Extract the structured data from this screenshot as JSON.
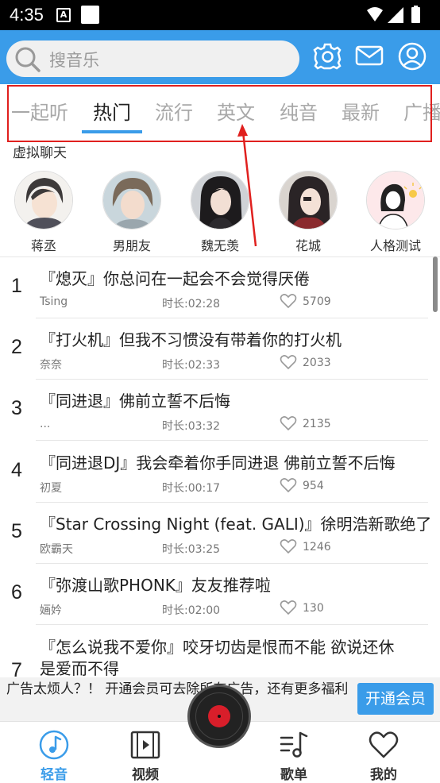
{
  "status_bar": {
    "time": "4:35",
    "notif_a": "A"
  },
  "header": {
    "search_placeholder": "搜音乐",
    "icons": [
      "gear-icon",
      "mail-icon",
      "user-icon"
    ]
  },
  "tabs": [
    "一起听",
    "热门",
    "流行",
    "英文",
    "纯音",
    "最新",
    "广播"
  ],
  "active_tab": "热门",
  "virtual_chat": {
    "title": "虚拟聊天",
    "characters": [
      "蒋丞",
      "男朋友",
      "魏无羡",
      "花城",
      "人格测试"
    ]
  },
  "songs": [
    {
      "rank": "1",
      "title": "『熄灭』你总问在一起会不会觉得厌倦",
      "artist": "Tsing",
      "duration": "时长:02:28",
      "likes": "5709"
    },
    {
      "rank": "2",
      "title": "『打火机』但我不习惯没有带着你的打火机",
      "artist": "奈奈",
      "duration": "时长:02:33",
      "likes": "2033"
    },
    {
      "rank": "3",
      "title": "『同进退』佛前立誓不后悔",
      "artist": "...",
      "duration": "时长:03:32",
      "likes": "2135"
    },
    {
      "rank": "4",
      "title": "『同进退DJ』我会牵着你手同进退 佛前立誓不后悔",
      "artist": "初夏",
      "duration": "时长:00:17",
      "likes": "954"
    },
    {
      "rank": "5",
      "title": "『Star Crossing Night (feat. GALI)』徐明浩新歌绝了",
      "artist": "欧霸天",
      "duration": "时长:03:25",
      "likes": "1246"
    },
    {
      "rank": "6",
      "title": "『弥渡山歌PHONK』友友推荐啦",
      "artist": "婳妗",
      "duration": "时长:02:00",
      "likes": "130"
    },
    {
      "rank": "7",
      "title": "『怎么说我不爱你』咬牙切齿是恨而不能 欲说还休",
      "title_line2": "是爱而不得"
    }
  ],
  "ad": {
    "text": "广告太烦人？！ 开通会员可去除所有广告，还有更多福利",
    "button": "开通会员"
  },
  "bottom_nav": [
    {
      "label": "轻音",
      "icon": "music-note-icon",
      "active": true
    },
    {
      "label": "视频",
      "icon": "film-icon",
      "active": false
    },
    {
      "label": "歌单",
      "icon": "songlist-icon",
      "active": false
    },
    {
      "label": "我的",
      "icon": "heart-icon",
      "active": false
    }
  ],
  "colors": {
    "accent": "#3a9ce9",
    "highlight_box": "#e0201e",
    "disc_center": "#d81e2a"
  }
}
